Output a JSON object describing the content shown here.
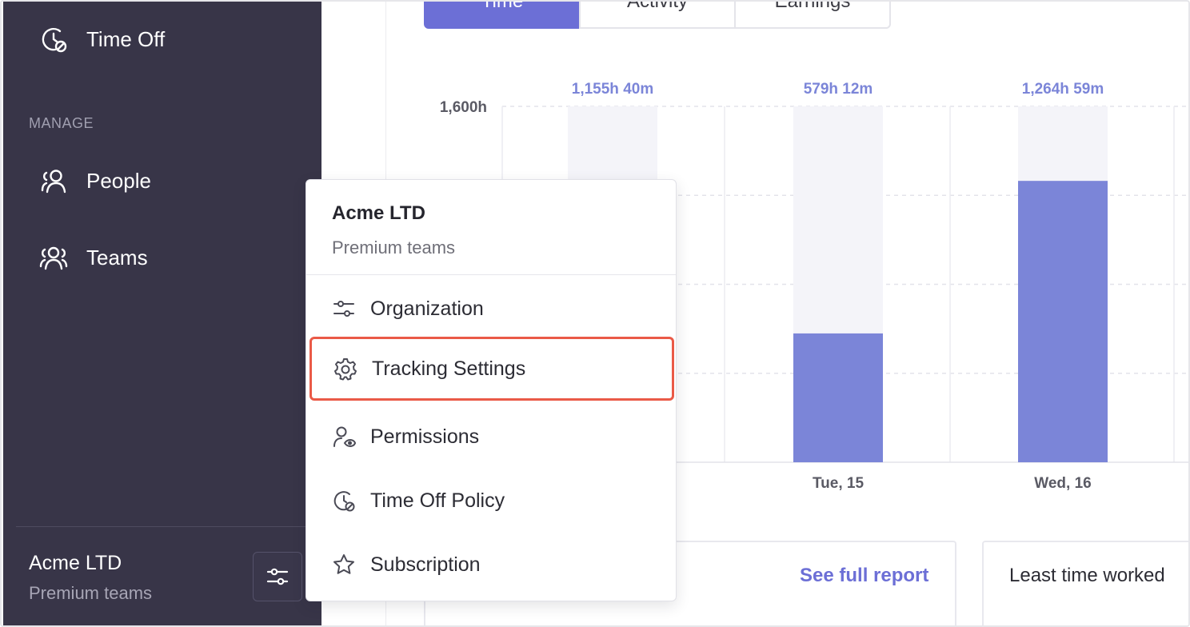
{
  "sidebar": {
    "time_off": "Time Off",
    "section_manage": "MANAGE",
    "people": "People",
    "teams": "Teams",
    "org_name": "Acme LTD",
    "org_plan": "Premium teams"
  },
  "tabs": [
    "Time",
    "Activity",
    "Earnings"
  ],
  "chart_data": {
    "type": "bar",
    "ytick": "1,600h",
    "ymax": 1600,
    "bars": [
      {
        "label": "",
        "total_label": "1,155h 40m",
        "value": 1155.67
      },
      {
        "label": "Tue, 15",
        "total_label": "579h 12m",
        "value": 579.2
      },
      {
        "label": "Wed, 16",
        "total_label": "1,264h 59m",
        "value": 1264.98
      }
    ],
    "bar_color": "#7b85d8",
    "track_color": "#f4f4f9"
  },
  "cards": {
    "see_full_report": "See full report",
    "least_time_worked": "Least time worked"
  },
  "dropdown": {
    "org_name": "Acme LTD",
    "org_plan": "Premium teams",
    "items": [
      "Organization",
      "Tracking Settings",
      "Permissions",
      "Time Off Policy",
      "Subscription"
    ]
  },
  "colors": {
    "sidebar_bg": "#383548",
    "accent": "#6c6fd6",
    "highlight": "#ea5a47"
  }
}
